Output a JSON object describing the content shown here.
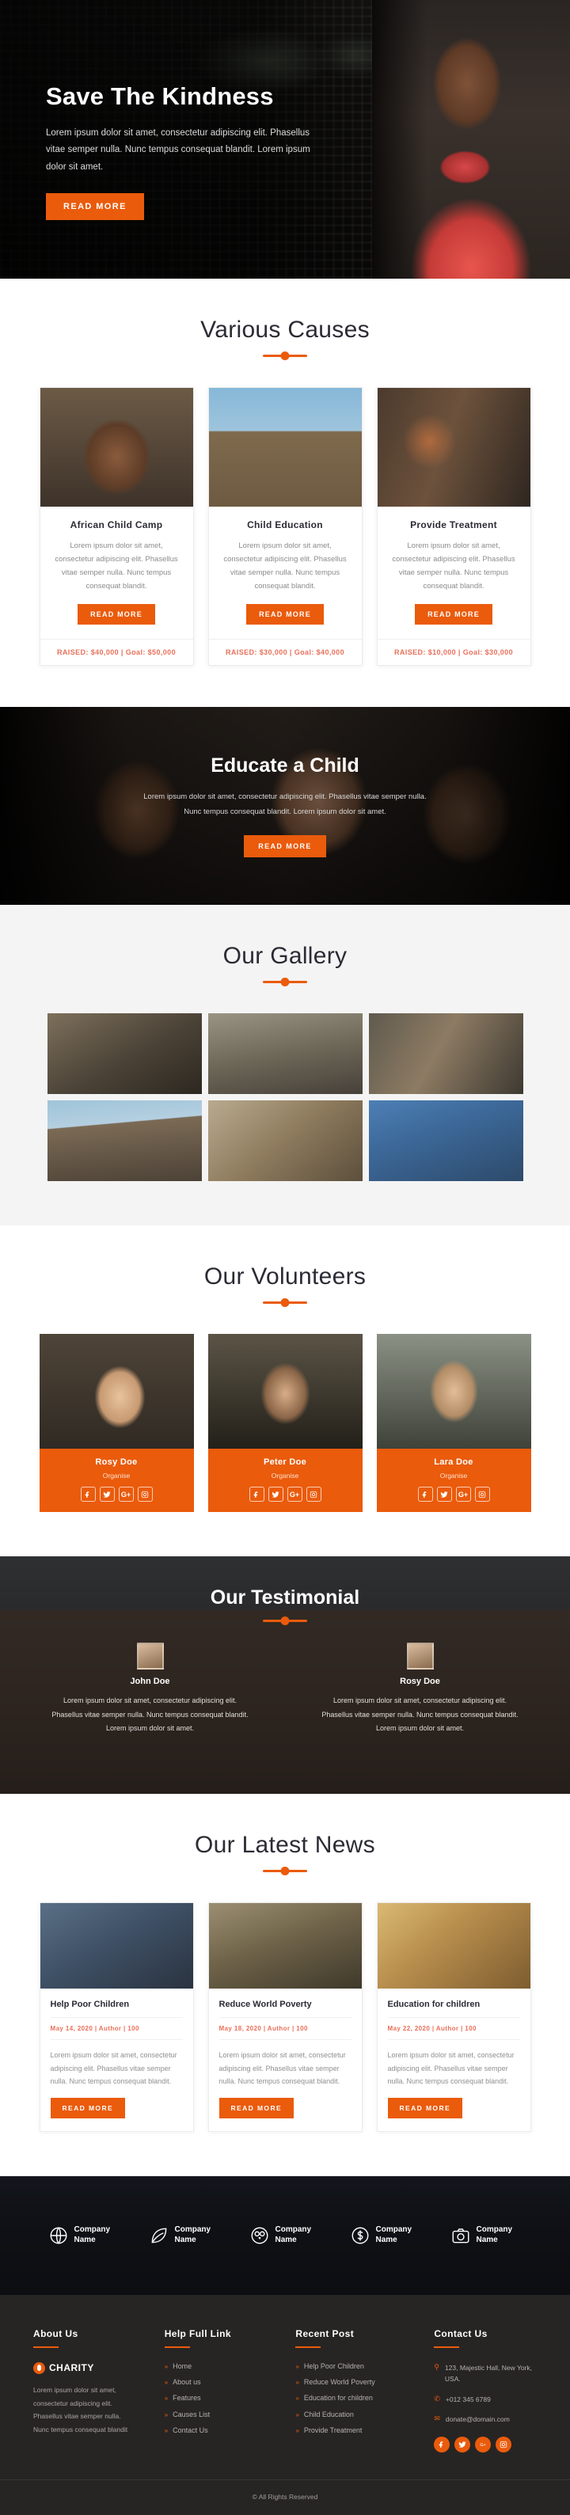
{
  "hero": {
    "title": "Save The Kindness",
    "description": "Lorem ipsum dolor sit amet, consectetur adipiscing elit. Phasellus vitae semper nulla. Nunc tempus consequat blandit. Lorem ipsum dolor sit amet.",
    "cta": "READ MORE"
  },
  "causes": {
    "title": "Various Causes",
    "items": [
      {
        "name": "African Child Camp",
        "description": "Lorem ipsum dolor sit amet, consectetur adipiscing elit. Phasellus vitae semper nulla. Nunc tempus consequat blandit.",
        "cta": "READ MORE",
        "raised": "RAISED: $40,000 | Goal: $50,000"
      },
      {
        "name": "Child Education",
        "description": "Lorem ipsum dolor sit amet, consectetur adipiscing elit. Phasellus vitae semper nulla. Nunc tempus consequat blandit.",
        "cta": "READ MORE",
        "raised": "RAISED: $30,000 | Goal: $40,000"
      },
      {
        "name": "Provide Treatment",
        "description": "Lorem ipsum dolor sit amet, consectetur adipiscing elit. Phasellus vitae semper nulla. Nunc tempus consequat blandit.",
        "cta": "READ MORE",
        "raised": "RAISED: $10,000 | Goal: $30,000"
      }
    ]
  },
  "educate": {
    "title": "Educate a Child",
    "description": "Lorem ipsum dolor sit amet, consectetur adipiscing elit. Phasellus vitae semper nulla. Nunc tempus consequat blandit. Lorem ipsum dolor sit amet.",
    "cta": "READ MORE"
  },
  "gallery": {
    "title": "Our Gallery",
    "cells": [
      "gallery-photo-1",
      "gallery-photo-2",
      "gallery-photo-3",
      "gallery-photo-4",
      "gallery-photo-5",
      "gallery-photo-6"
    ]
  },
  "volunteers": {
    "title": "Our Volunteers",
    "items": [
      {
        "name": "Rosy Doe",
        "role": "Organise"
      },
      {
        "name": "Peter Doe",
        "role": "Organise"
      },
      {
        "name": "Lara Doe",
        "role": "Organise"
      }
    ],
    "social": [
      "facebook-icon",
      "twitter-icon",
      "google-plus-icon",
      "instagram-icon"
    ]
  },
  "testimonial": {
    "title": "Our Testimonial",
    "items": [
      {
        "name": "John Doe",
        "quote": "Lorem ipsum dolor sit amet, consectetur adipiscing elit. Phasellus vitae semper nulla. Nunc tempus consequat blandit. Lorem ipsum dolor sit amet."
      },
      {
        "name": "Rosy Doe",
        "quote": "Lorem ipsum dolor sit amet, consectetur adipiscing elit. Phasellus vitae semper nulla. Nunc tempus consequat blandit. Lorem ipsum dolor sit amet."
      }
    ]
  },
  "news": {
    "title": "Our Latest News",
    "items": [
      {
        "headline": "Help Poor Children",
        "meta": "May 14, 2020 | Author | 100",
        "excerpt": "Lorem ipsum dolor sit amet, consectetur adipiscing elit. Phasellus vitae semper nulla. Nunc tempus consequat blandit.",
        "cta": "READ MORE"
      },
      {
        "headline": "Reduce World Poverty",
        "meta": "May 18, 2020 | Author | 100",
        "excerpt": "Lorem ipsum dolor sit amet, consectetur adipiscing elit. Phasellus vitae semper nulla. Nunc tempus consequat blandit.",
        "cta": "READ MORE"
      },
      {
        "headline": "Education for children",
        "meta": "May 22, 2020 | Author | 100",
        "excerpt": "Lorem ipsum dolor sit amet, consectetur adipiscing elit. Phasellus vitae semper nulla. Nunc tempus consequat blandit.",
        "cta": "READ MORE"
      }
    ]
  },
  "sponsors": [
    {
      "name": "Company Name",
      "icon": "globe-icon"
    },
    {
      "name": "Company Name",
      "icon": "leaf-icon"
    },
    {
      "name": "Company Name",
      "icon": "owl-icon"
    },
    {
      "name": "Company Name",
      "icon": "dollar-icon"
    },
    {
      "name": "Company Name",
      "icon": "camera-icon"
    }
  ],
  "footer": {
    "about": {
      "title": "About Us",
      "brand": "CHARITY",
      "text": "Lorem ipsum dolor sit amet, consectetur adipiscing elit. Phasellus vitae semper nulla. Nunc tempus consequat blandit"
    },
    "help": {
      "title": "Help Full Link",
      "links": [
        "Home",
        "About us",
        "Features",
        "Causes List",
        "Contact Us"
      ]
    },
    "recent": {
      "title": "Recent Post",
      "links": [
        "Help Poor Children",
        "Reduce World Poverty",
        "Education for children",
        "Child Education",
        "Provide Treatment"
      ]
    },
    "contact": {
      "title": "Contact Us",
      "address": "123, Majestic Hall, New York, USA.",
      "phone": "+012 345 6789",
      "email": "donate@domain.com",
      "social": [
        "facebook-icon",
        "twitter-icon",
        "google-plus-icon",
        "instagram-icon"
      ]
    },
    "copyright": "© All Rights Reserved"
  },
  "colors": {
    "accent": "#ea5b0c",
    "dark": "#272523",
    "muted": "#8b8b8b"
  }
}
